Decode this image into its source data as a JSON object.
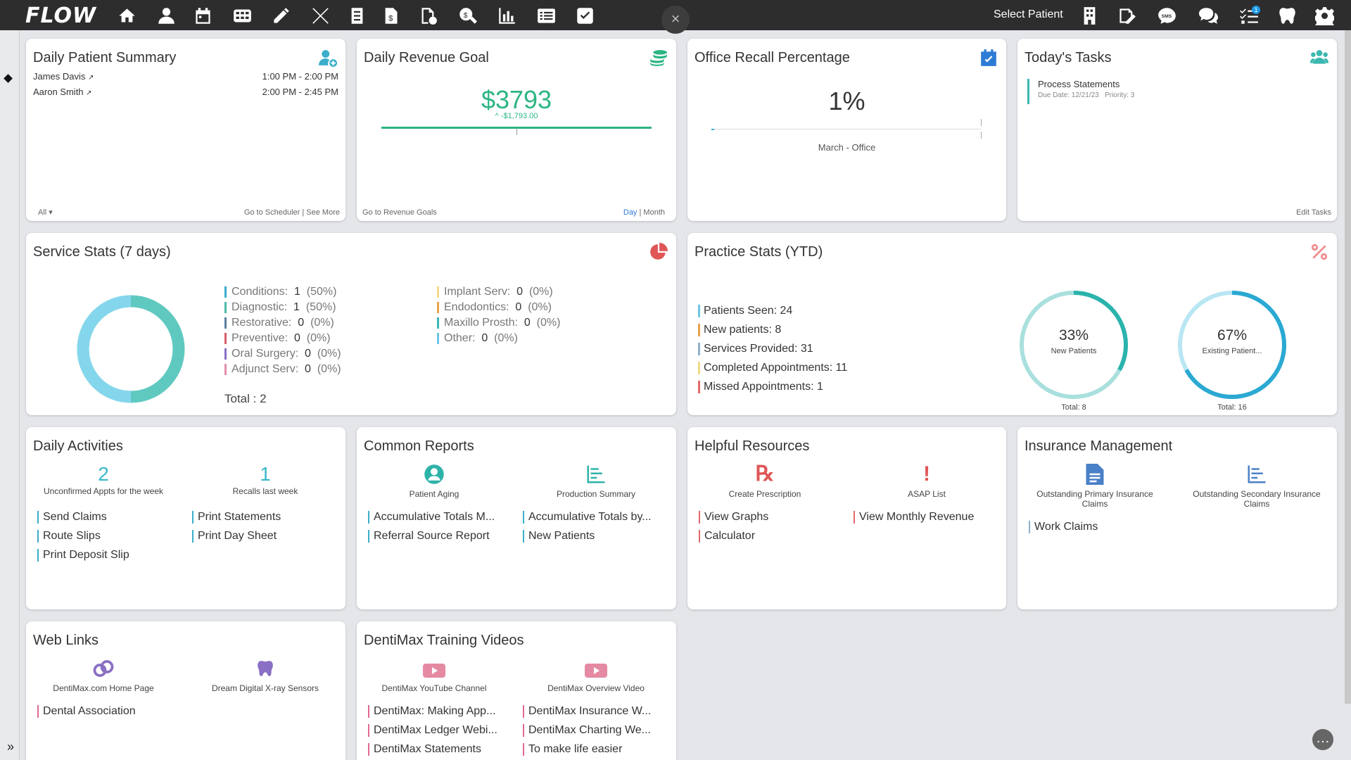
{
  "app": {
    "logo": "FLOW",
    "select_patient": "Select Patient",
    "tasks_badge": "1"
  },
  "nav_icons": [
    "home-icon",
    "person-icon",
    "calendar-icon",
    "grid-icon",
    "pencil-icon",
    "tools-icon",
    "ledger-icon",
    "bill-icon",
    "file-check-icon",
    "search-dollar-icon",
    "bar-chart-icon",
    "list-icon",
    "checkbox-icon"
  ],
  "right_icons": [
    "building-icon",
    "signature-icon",
    "sms-icon",
    "chat-icon",
    "task-list-icon",
    "tooth-icon",
    "settings-icon"
  ],
  "colors": {
    "accent": "#3bb8b0",
    "money": "#2cb582",
    "danger": "#e05656"
  },
  "daily_patient_summary": {
    "title": "Daily Patient Summary",
    "patients": [
      {
        "name": "James Davis",
        "time": "1:00 PM - 2:00 PM"
      },
      {
        "name": "Aaron Smith",
        "time": "2:00 PM - 2:45 PM"
      }
    ],
    "filter": "All",
    "go_scheduler": "Go to Scheduler",
    "see_more": "See More"
  },
  "daily_revenue_goal": {
    "title": "Daily Revenue Goal",
    "amount": "$3793",
    "diff": "^ -$1,793.00",
    "go_link": "Go to Revenue Goals",
    "day": "Day",
    "month": "Month",
    "progress": 1.0
  },
  "office_recall": {
    "title": "Office Recall Percentage",
    "value": "1%",
    "label": "March - Office",
    "progress": 0.01
  },
  "todays_tasks": {
    "title": "Today's Tasks",
    "task_name": "Process Statements",
    "due": "Due Date: 12/21/23",
    "priority": "Priority: 3",
    "edit": "Edit Tasks"
  },
  "service_stats": {
    "title": "Service Stats (7 days)",
    "col1": [
      {
        "label": "Conditions:",
        "count": "1",
        "pct": "(50%)",
        "color": "#3aaecb"
      },
      {
        "label": "Diagnostic:",
        "count": "1",
        "pct": "(50%)",
        "color": "#4fb9a8"
      },
      {
        "label": "Restorative:",
        "count": "0",
        "pct": "(0%)",
        "color": "#5b7fa0"
      },
      {
        "label": "Preventive:",
        "count": "0",
        "pct": "(0%)",
        "color": "#d85d6a"
      },
      {
        "label": "Oral Surgery:",
        "count": "0",
        "pct": "(0%)",
        "color": "#8a6fc4"
      },
      {
        "label": "Adjunct Serv:",
        "count": "0",
        "pct": "(0%)",
        "color": "#e48fa8"
      }
    ],
    "col2": [
      {
        "label": "Implant Serv:",
        "count": "0",
        "pct": "(0%)",
        "color": "#f1d98a"
      },
      {
        "label": "Endodontics:",
        "count": "0",
        "pct": "(0%)",
        "color": "#e9a24b"
      },
      {
        "label": "Maxillo Prosth:",
        "count": "0",
        "pct": "(0%)",
        "color": "#3bb8b0"
      },
      {
        "label": "Other:",
        "count": "0",
        "pct": "(0%)",
        "color": "#6ec6e6"
      }
    ],
    "total_label": "Total :",
    "total": "2"
  },
  "practice_stats": {
    "title": "Practice Stats (YTD)",
    "stats": [
      {
        "text": "Patients Seen: 24",
        "color": "#6ec6e6"
      },
      {
        "text": "New patients: 8",
        "color": "#e9a24b"
      },
      {
        "text": "Services Provided: 31",
        "color": "#8fb1c9"
      },
      {
        "text": "Completed Appointments: 11",
        "color": "#f1d98a"
      },
      {
        "text": "Missed Appointments: 1",
        "color": "#e26a6a"
      }
    ],
    "rings": [
      {
        "pct_text": "33%",
        "label": "New Patients",
        "total": "Total: 8",
        "fraction": 0.33,
        "fg": "#2bb3ad",
        "bg": "#a9e0dd"
      },
      {
        "pct_text": "67%",
        "label": "Existing Patient...",
        "total": "Total: 16",
        "fraction": 0.67,
        "fg": "#2ba9d3",
        "bg": "#b9e6f3"
      }
    ]
  },
  "daily_activities": {
    "title": "Daily Activities",
    "q1": {
      "num": "2",
      "label": "Unconfirmed Appts for the week"
    },
    "q2": {
      "num": "1",
      "label": "Recalls last week"
    },
    "links": [
      "Send Claims",
      "Print Statements",
      "Route Slips",
      "Print Day Sheet",
      "Print Deposit Slip"
    ]
  },
  "common_reports": {
    "title": "Common Reports",
    "q1": "Patient Aging",
    "q2": "Production Summary",
    "links": [
      "Accumulative Totals M...",
      "Accumulative Totals by...",
      "Referral Source Report",
      "New Patients"
    ]
  },
  "helpful_resources": {
    "title": "Helpful Resources",
    "q1": "Create Prescription",
    "q2": "ASAP List",
    "links": [
      "View Graphs",
      "View Monthly Revenue",
      "Calculator"
    ]
  },
  "insurance_management": {
    "title": "Insurance Management",
    "q1": "Outstanding Primary Insurance Claims",
    "q2": "Outstanding Secondary Insurance Claims",
    "links": [
      "Work Claims"
    ]
  },
  "web_links": {
    "title": "Web Links",
    "q1": "DentiMax.com Home Page",
    "q2": "Dream Digital X-ray Sensors",
    "links": [
      "Dental Association"
    ]
  },
  "training_videos": {
    "title": "DentiMax Training Videos",
    "q1": "DentiMax YouTube Channel",
    "q2": "DentiMax Overview Video",
    "links": [
      "DentiMax: Making App...",
      "DentiMax Insurance W...",
      "DentiMax Ledger Webi...",
      "DentiMax Charting We...",
      "DentiMax Statements",
      "To make life easier"
    ]
  }
}
